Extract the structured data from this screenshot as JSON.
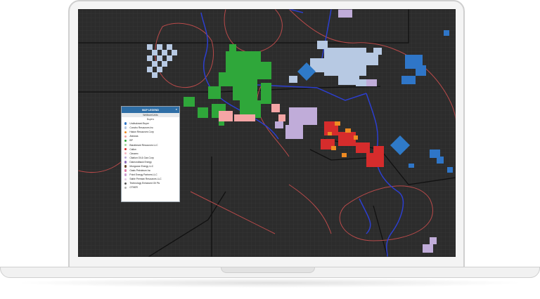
{
  "legend": {
    "title": "MAP LEGEND",
    "close_icon": "close-x",
    "subheader": "Wellbore/Units",
    "group": "Buyers",
    "items": [
      {
        "label": "Undisclosed Buyer",
        "color": "#2f76c8"
      },
      {
        "label": "Conoho Resources Inc",
        "color": "#b4c6e0"
      },
      {
        "label": "Hakon Resources Corp",
        "color": "#ee8a22"
      },
      {
        "label": "Abraxas",
        "color": "#f0a0a0"
      },
      {
        "label": "BP",
        "color": "#2fa73a"
      },
      {
        "label": "Blackbeard Resources LLC",
        "color": "#9ed69e"
      },
      {
        "label": "Callon",
        "color": "#d62c2c"
      },
      {
        "label": "Cimarex",
        "color": "#f4b6c2"
      },
      {
        "label": "Citation Oil & Gas Corp",
        "color": "#b7a6d6"
      },
      {
        "label": "Diamondback Energy",
        "color": "#8e6cb8"
      },
      {
        "label": "Mongoose Energy LLC",
        "color": "#6b4a2e"
      },
      {
        "label": "Oasis Petroleum Inc",
        "color": "#e07aa6"
      },
      {
        "label": "Point Energy Partners LLC",
        "color": "#c89ad0"
      },
      {
        "label": "Sable Permian Resources LLC",
        "color": "#e6c8e6"
      },
      {
        "label": "Technology Enhanced Oil Plc",
        "color": "#555555"
      },
      {
        "label": "OTHER",
        "color": "#b0b0b0"
      }
    ]
  }
}
